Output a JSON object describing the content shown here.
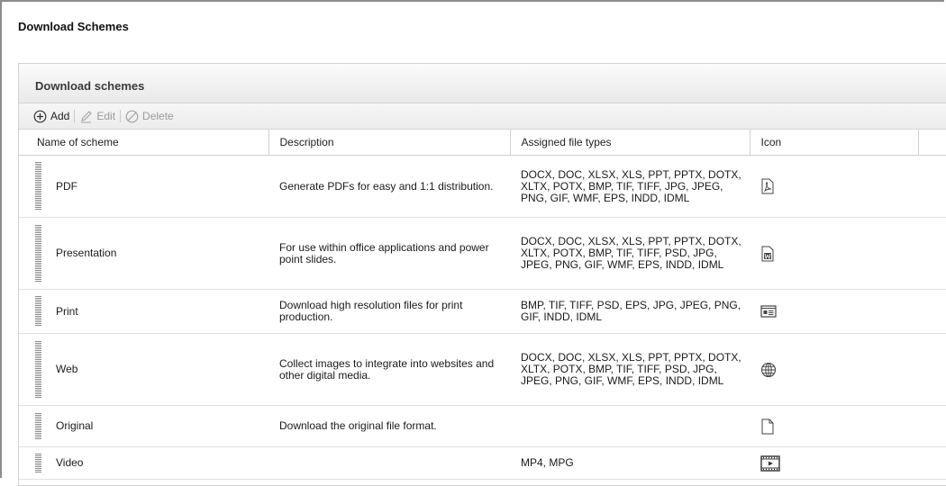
{
  "page": {
    "title": "Download Schemes"
  },
  "panel": {
    "title": "Download schemes"
  },
  "toolbar": {
    "add_label": "Add",
    "edit_label": "Edit",
    "delete_label": "Delete"
  },
  "columns": {
    "name": "Name of scheme",
    "description": "Description",
    "file_types": "Assigned file types",
    "icon": "Icon"
  },
  "rows": [
    {
      "name": "PDF",
      "description": "Generate PDFs for easy and 1:1 distribution.",
      "file_types": "DOCX, DOC, XLSX, XLS, PPT, PPTX, DOTX, XLTX, POTX, BMP, TIF, TIFF, JPG, JPEG, PNG, GIF, WMF, EPS, INDD, IDML",
      "icon": "pdf-file-icon"
    },
    {
      "name": "Presentation",
      "description": "For use within office applications and power point slides.",
      "file_types": "DOCX, DOC, XLSX, XLS, PPT, PPTX, DOTX, XLTX, POTX, BMP, TIF, TIFF, PSD, JPG, JPEG, PNG, GIF, WMF, EPS, INDD, IDML",
      "icon": "word-file-icon"
    },
    {
      "name": "Print",
      "description": "Download high resolution files for print production.",
      "file_types": "BMP, TIF, TIFF, PSD, EPS, JPG, JPEG, PNG, GIF, INDD, IDML",
      "icon": "print-layout-icon"
    },
    {
      "name": "Web",
      "description": "Collect images to integrate into websites and other digital media.",
      "file_types": "DOCX, DOC, XLSX, XLS, PPT, PPTX, DOTX, XLTX, POTX, BMP, TIF, TIFF, PSD, JPG, JPEG, PNG, GIF, WMF, EPS, INDD, IDML",
      "icon": "globe-icon"
    },
    {
      "name": "Original",
      "description": "Download the original file format.",
      "file_types": "",
      "icon": "blank-file-icon"
    },
    {
      "name": "Video",
      "description": "",
      "file_types": "MP4, MPG",
      "icon": "video-film-icon"
    }
  ]
}
